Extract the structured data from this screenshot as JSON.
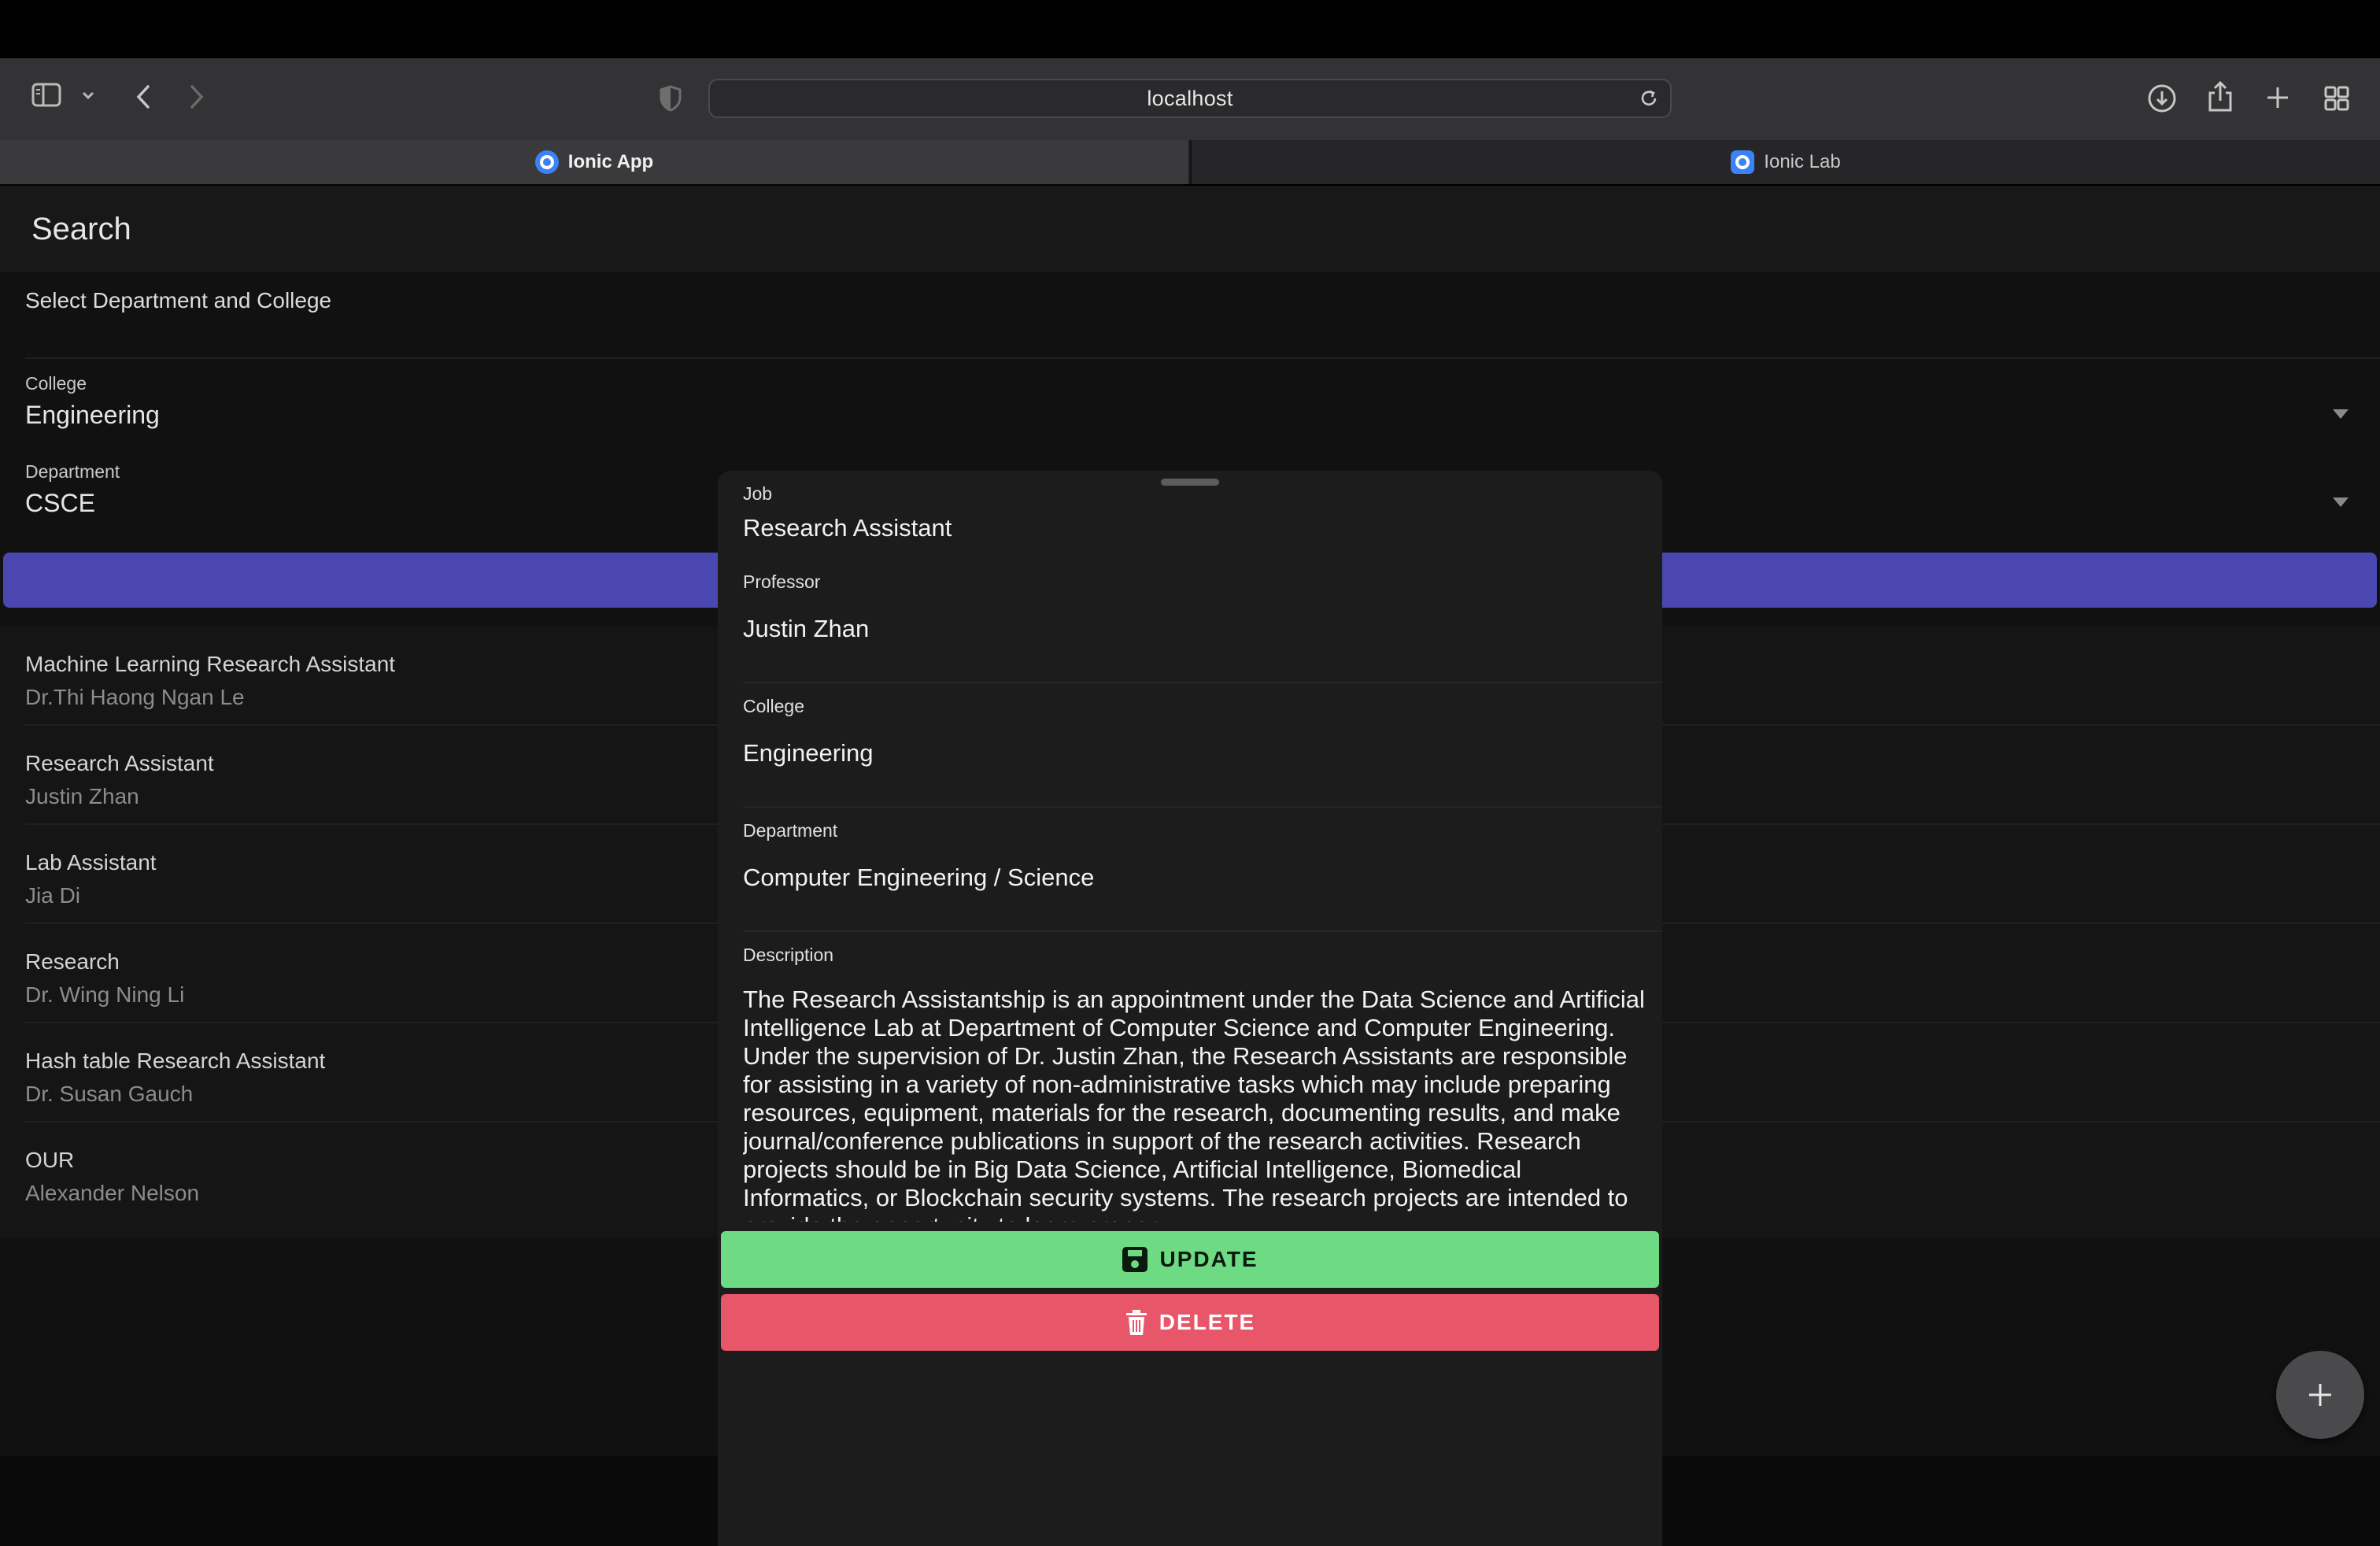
{
  "browser": {
    "url": "localhost",
    "tabs": [
      {
        "label": "Ionic App",
        "active": true
      },
      {
        "label": "Ionic Lab",
        "active": false
      }
    ]
  },
  "app": {
    "title": "Search",
    "select_section_title": "Select Department and College",
    "college": {
      "label": "College",
      "value": "Engineering"
    },
    "department": {
      "label": "Department",
      "value": "CSCE"
    },
    "results": [
      {
        "title": "Machine Learning Research Assistant",
        "professor": "Dr.Thi Haong Ngan Le"
      },
      {
        "title": "Research Assistant",
        "professor": "Justin Zhan"
      },
      {
        "title": "Lab Assistant",
        "professor": "Jia Di"
      },
      {
        "title": "Research",
        "professor": "Dr. Wing Ning Li"
      },
      {
        "title": "Hash table Research Assistant",
        "professor": "Dr. Susan Gauch"
      },
      {
        "title": "OUR",
        "professor": "Alexander Nelson"
      }
    ]
  },
  "modal": {
    "job": {
      "label": "Job",
      "value": "Research Assistant"
    },
    "professor": {
      "label": "Professor",
      "value": "Justin Zhan"
    },
    "college": {
      "label": "College",
      "value": "Engineering"
    },
    "department": {
      "label": "Department",
      "value": "Computer Engineering / Science"
    },
    "description": {
      "label": "Description",
      "value": " The Research Assistantship is an appointment under the Data Science and Artificial Intelligence Lab at Department of Computer Science and Computer Engineering. Under the supervision of Dr. Justin Zhan, the Research Assistants are responsible for assisting in a variety of non-administrative tasks which may include preparing resources, equipment, materials for the research, documenting results, and make journal/conference publications in support of the research activities. Research projects should be in Big Data Science, Artificial Intelligence, Biomedical Informatics, or Blockchain security systems. The research projects are intended to provide the opportunity to learn proper"
    },
    "update_label": "UPDATE",
    "delete_label": "DELETE"
  },
  "colors": {
    "update": "#6edb84",
    "delete": "#e8566a",
    "primary": "#4a48b0"
  }
}
